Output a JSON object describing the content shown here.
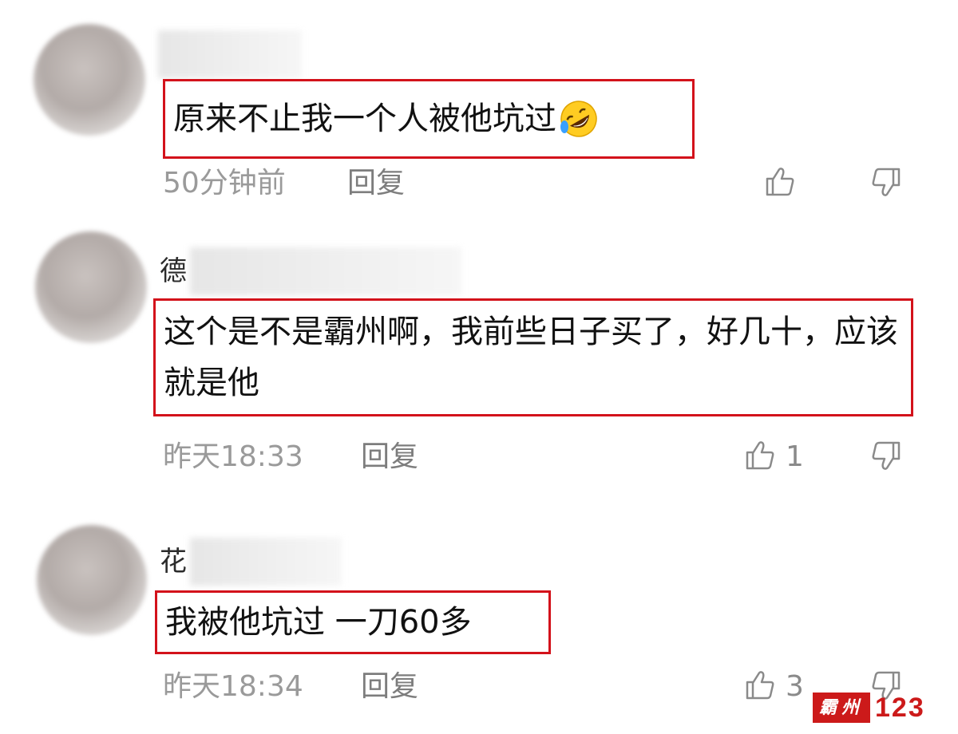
{
  "comments": [
    {
      "name_prefix": "",
      "text": "原来不止我一个人被他坑过",
      "emoji": "rofl-emoji",
      "time": "50分钟前",
      "reply_label": "回复",
      "like_count": ""
    },
    {
      "name_prefix": "德",
      "text": "这个是不是霸州啊，我前些日子买了，好几十，应该就是他",
      "time": "昨天18:33",
      "reply_label": "回复",
      "like_count": "1"
    },
    {
      "name_prefix": "花",
      "text": "我被他坑过 一刀60多",
      "time": "昨天18:34",
      "reply_label": "回复",
      "like_count": "3"
    }
  ],
  "watermark": {
    "seal_text": "霸州",
    "number": "123"
  },
  "colors": {
    "highlight_border": "#d3121b",
    "meta_text": "#9a9a9a",
    "watermark_red": "#cc1a1a"
  },
  "icons": [
    "thumbs-up-icon",
    "thumbs-down-icon",
    "rofl-emoji"
  ]
}
